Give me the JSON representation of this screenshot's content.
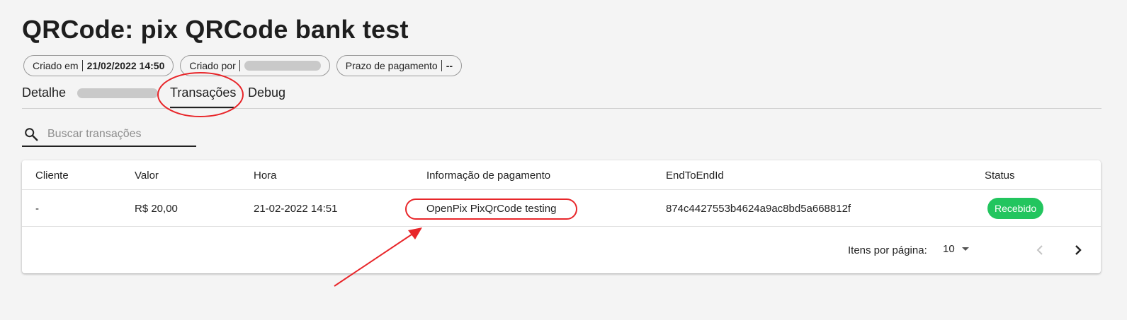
{
  "header": {
    "title": "QRCode: pix QRCode bank test"
  },
  "chips": [
    {
      "label": "Criado em",
      "value": "21/02/2022 14:50"
    },
    {
      "label": "Criado por",
      "value": ""
    },
    {
      "label": "Prazo de pagamento",
      "value": "--"
    }
  ],
  "tabs": [
    {
      "label": "Detalhe"
    },
    {
      "label": "Transações",
      "active": true
    },
    {
      "label": "Debug"
    }
  ],
  "search": {
    "placeholder": "Buscar transações",
    "value": "",
    "icon": "search-icon"
  },
  "table": {
    "columns": [
      "Cliente",
      "Valor",
      "Hora",
      "Informação de pagamento",
      "EndToEndId",
      "Status"
    ],
    "rows": [
      {
        "cliente": "-",
        "valor": "R$ 20,00",
        "hora": "21-02-2022 14:51",
        "info": "OpenPix PixQrCode testing",
        "endtoend": "874c4427553b4624a9ac8bd5a668812f",
        "status": "Recebido"
      }
    ]
  },
  "pagination": {
    "label": "Itens por página:",
    "per_page": "10",
    "prev_icon": "chevron-left-icon",
    "next_icon": "chevron-right-icon"
  },
  "colors": {
    "status_received": "#22c55e",
    "annotation": "#e8262a",
    "background": "#f4f4f4"
  }
}
